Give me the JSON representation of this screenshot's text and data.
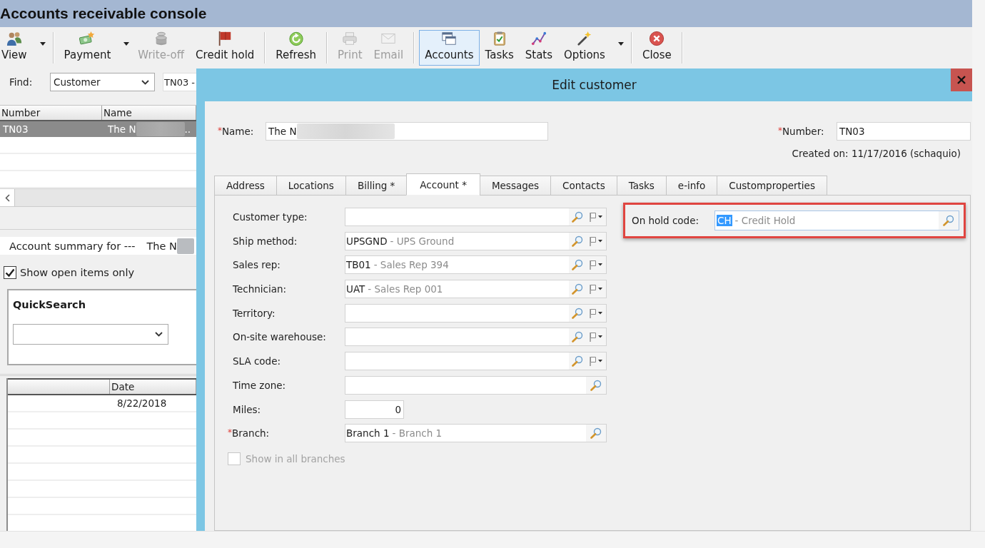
{
  "window": {
    "title": "Accounts receivable console"
  },
  "toolbar": [
    {
      "label": "View",
      "dropdown": true,
      "disabled": false,
      "selected": false,
      "group_end": true
    },
    {
      "label": "Payment",
      "dropdown": true,
      "disabled": false,
      "selected": false,
      "group_end": false
    },
    {
      "label": "Write-off",
      "dropdown": false,
      "disabled": true,
      "selected": false,
      "group_end": false
    },
    {
      "label": "Credit hold",
      "dropdown": false,
      "disabled": false,
      "selected": false,
      "group_end": true
    },
    {
      "label": "Refresh",
      "dropdown": false,
      "disabled": false,
      "selected": false,
      "group_end": true
    },
    {
      "label": "Print",
      "dropdown": false,
      "disabled": true,
      "selected": false,
      "group_end": false
    },
    {
      "label": "Email",
      "dropdown": false,
      "disabled": true,
      "selected": false,
      "group_end": true
    },
    {
      "label": "Accounts",
      "dropdown": false,
      "disabled": false,
      "selected": true,
      "group_end": false
    },
    {
      "label": "Tasks",
      "dropdown": false,
      "disabled": false,
      "selected": false,
      "group_end": false
    },
    {
      "label": "Stats",
      "dropdown": false,
      "disabled": false,
      "selected": false,
      "group_end": false
    },
    {
      "label": "Options",
      "dropdown": true,
      "disabled": false,
      "selected": false,
      "group_end": true
    },
    {
      "label": "Close",
      "dropdown": false,
      "disabled": false,
      "selected": false,
      "group_end": true
    }
  ],
  "find": {
    "label": "Find:",
    "scope": "Customer",
    "query": "TN03 -"
  },
  "customer_grid": {
    "columns": [
      "Number",
      "Name"
    ],
    "rows": [
      {
        "number": "TN03",
        "name": "The N",
        "redacted": true,
        "name_tail": "..",
        "selected": true
      }
    ]
  },
  "account_summary": {
    "label": "Account summary for ---",
    "customer": "The N",
    "redacted": true
  },
  "open_items_only": {
    "label": "Show open items only",
    "checked": true
  },
  "quick_search": {
    "title": "QuickSearch"
  },
  "items_grid": {
    "date_column": "Date",
    "rows": [
      {
        "date": "8/22/2018"
      }
    ]
  },
  "dialog": {
    "title": "Edit customer",
    "name": {
      "label": "Name:",
      "required_mark": "*",
      "value": "The N",
      "redacted": true
    },
    "number": {
      "label": "Number:",
      "required_mark": "*",
      "value": "TN03"
    },
    "created": "Created on: 11/17/2016 (schaquio)",
    "tabs": [
      {
        "label": "Address",
        "selected": false
      },
      {
        "label": "Locations",
        "selected": false
      },
      {
        "label": "Billing *",
        "selected": false
      },
      {
        "label": "Account *",
        "selected": true
      },
      {
        "label": "Messages",
        "selected": false
      },
      {
        "label": "Contacts",
        "selected": false
      },
      {
        "label": "Tasks",
        "selected": false
      },
      {
        "label": "e-info",
        "selected": false
      },
      {
        "label": "Customproperties",
        "selected": false
      }
    ],
    "fields": [
      {
        "label": "Customer type:",
        "kind": "lookup_flag"
      },
      {
        "label": "Ship method:",
        "kind": "lookup_flag",
        "code": "UPSGND",
        "description": "- UPS Ground"
      },
      {
        "label": "Sales rep:",
        "kind": "lookup_flag",
        "code": "TB01",
        "description": "- Sales Rep 394"
      },
      {
        "label": "Technician:",
        "kind": "lookup_flag",
        "code": "UAT",
        "description": "- Sales Rep 001"
      },
      {
        "label": "Territory:",
        "kind": "lookup_flag"
      },
      {
        "label": "On-site warehouse:",
        "kind": "lookup_flag"
      },
      {
        "label": "SLA code:",
        "kind": "lookup_flag"
      },
      {
        "label": "Time zone:",
        "kind": "lookup"
      },
      {
        "label": "Miles:",
        "kind": "number",
        "value": "0"
      },
      {
        "label": "Branch:",
        "kind": "lookup",
        "required_mark": "*",
        "code": "Branch 1",
        "description": "- Branch 1"
      }
    ],
    "show_all_branches": {
      "label": "Show in all branches",
      "checked": false,
      "disabled": true
    },
    "on_hold": {
      "label": "On hold code:",
      "code": "CH",
      "description": "- Credit Hold",
      "code_selected": true,
      "highlighted": true
    }
  }
}
